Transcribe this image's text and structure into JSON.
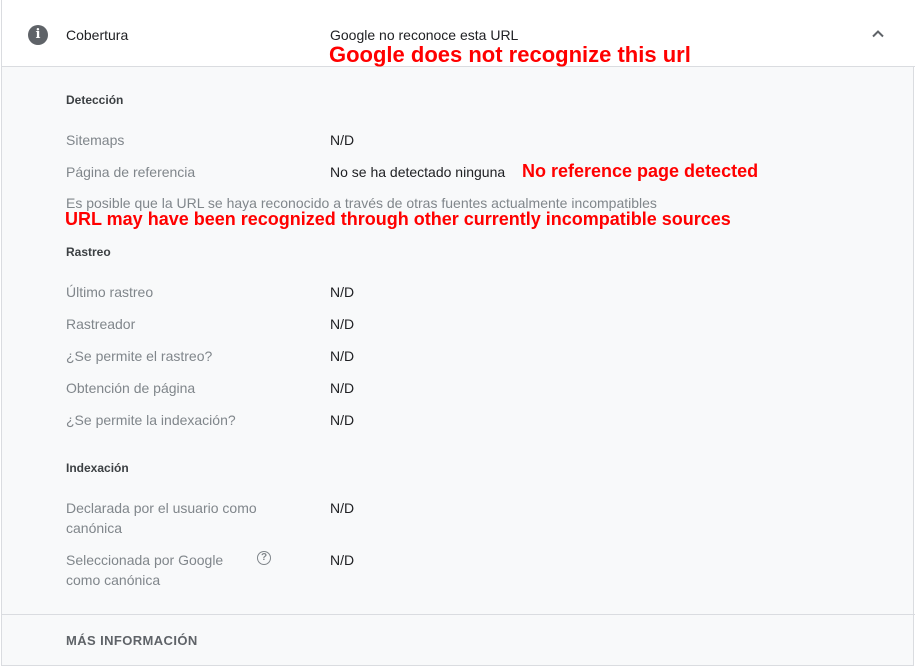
{
  "header": {
    "title": "Cobertura",
    "status": "Google no reconoce esta URL",
    "info_icon": "info-icon",
    "collapse_icon": "chevron-up-icon"
  },
  "annotations": {
    "status_translation": "Google does not recognize this url",
    "referring_translation": "No reference page detected",
    "note_translation": "URL may have been recognized through other currently incompatible sources",
    "color": "#ff0000"
  },
  "discovery": {
    "title": "Detección",
    "rows": [
      {
        "label": "Sitemaps",
        "value": "N/D"
      },
      {
        "label": "Página de referencia",
        "value": "No se ha detectado ninguna"
      }
    ],
    "note": "Es posible que la URL se haya reconocido a través de otras fuentes actualmente incompatibles"
  },
  "crawl": {
    "title": "Rastreo",
    "rows": [
      {
        "label": "Último rastreo",
        "value": "N/D"
      },
      {
        "label": "Rastreador",
        "value": "N/D"
      },
      {
        "label": "¿Se permite el rastreo?",
        "value": "N/D"
      },
      {
        "label": "Obtención de página",
        "value": "N/D"
      },
      {
        "label": "¿Se permite la indexación?",
        "value": "N/D"
      }
    ]
  },
  "indexing": {
    "title": "Indexación",
    "rows": [
      {
        "label": "Declarada por el usuario como canónica",
        "value": "N/D"
      },
      {
        "label": "Seleccionada por Google como canónica",
        "value": "N/D",
        "help_icon": "help-circle-icon"
      }
    ]
  },
  "footer": {
    "link": "MÁS INFORMACIÓN"
  }
}
